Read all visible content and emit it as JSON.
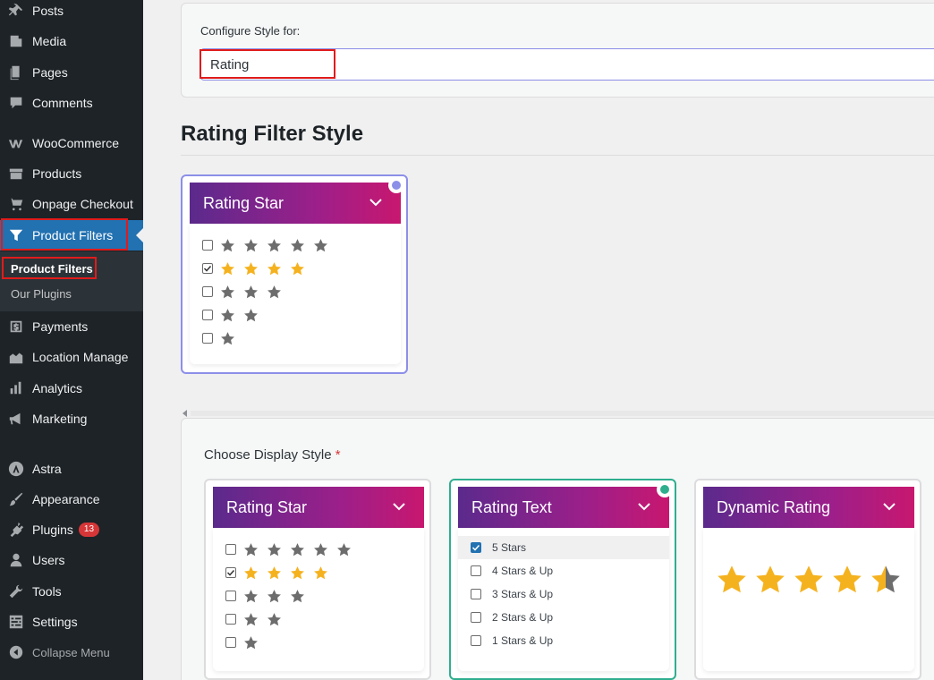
{
  "sidebar": {
    "items": [
      {
        "label": "Posts",
        "icon": "pin-icon"
      },
      {
        "label": "Media",
        "icon": "media-icon"
      },
      {
        "label": "Pages",
        "icon": "pages-icon"
      },
      {
        "label": "Comments",
        "icon": "comment-icon"
      },
      {
        "label": "WooCommerce",
        "icon": "woo-icon"
      },
      {
        "label": "Products",
        "icon": "archive-icon"
      },
      {
        "label": "Onpage Checkout",
        "icon": "cart-icon"
      },
      {
        "label": "Product Filters",
        "icon": "filter-icon"
      },
      {
        "label": "Payments",
        "icon": "dollar-icon"
      },
      {
        "label": "Location Manage",
        "icon": "location-icon"
      },
      {
        "label": "Analytics",
        "icon": "chart-icon"
      },
      {
        "label": "Marketing",
        "icon": "megaphone-icon"
      },
      {
        "label": "Astra",
        "icon": "astra-icon"
      },
      {
        "label": "Appearance",
        "icon": "brush-icon"
      },
      {
        "label": "Plugins",
        "icon": "plug-icon",
        "badge": "13"
      },
      {
        "label": "Users",
        "icon": "user-icon"
      },
      {
        "label": "Tools",
        "icon": "wrench-icon"
      },
      {
        "label": "Settings",
        "icon": "settings-icon"
      }
    ],
    "submenu": [
      "Product Filters",
      "Our Plugins"
    ],
    "collapse_label": "Collapse Menu"
  },
  "config": {
    "label": "Configure Style for:",
    "selected": "Rating"
  },
  "section_title": "Rating Filter Style",
  "preview": {
    "title": "Rating Star",
    "rows": [
      {
        "stars": 5,
        "checked": false
      },
      {
        "stars": 4,
        "checked": true
      },
      {
        "stars": 3,
        "checked": false
      },
      {
        "stars": 2,
        "checked": false
      },
      {
        "stars": 1,
        "checked": false
      }
    ]
  },
  "choose": {
    "label": "Choose Display Style",
    "required_mark": "*",
    "styles": [
      {
        "title": "Rating Star"
      },
      {
        "title": "Rating Text",
        "options": [
          "5 Stars",
          "4 Stars & Up",
          "3 Stars & Up",
          "2 Stars & Up",
          "1 Stars & Up"
        ],
        "selected_index": 0
      },
      {
        "title": "Dynamic Rating",
        "rating": 4.5
      }
    ]
  },
  "colors": {
    "sidebar_bg": "#1d2327",
    "active_menu": "#2271b1",
    "highlight_red": "#e01b1b",
    "star_gold": "#f5b21f",
    "star_grey": "#6d6d6d",
    "selected_green": "#2fae8e",
    "selected_blue": "#8c8fe8"
  }
}
